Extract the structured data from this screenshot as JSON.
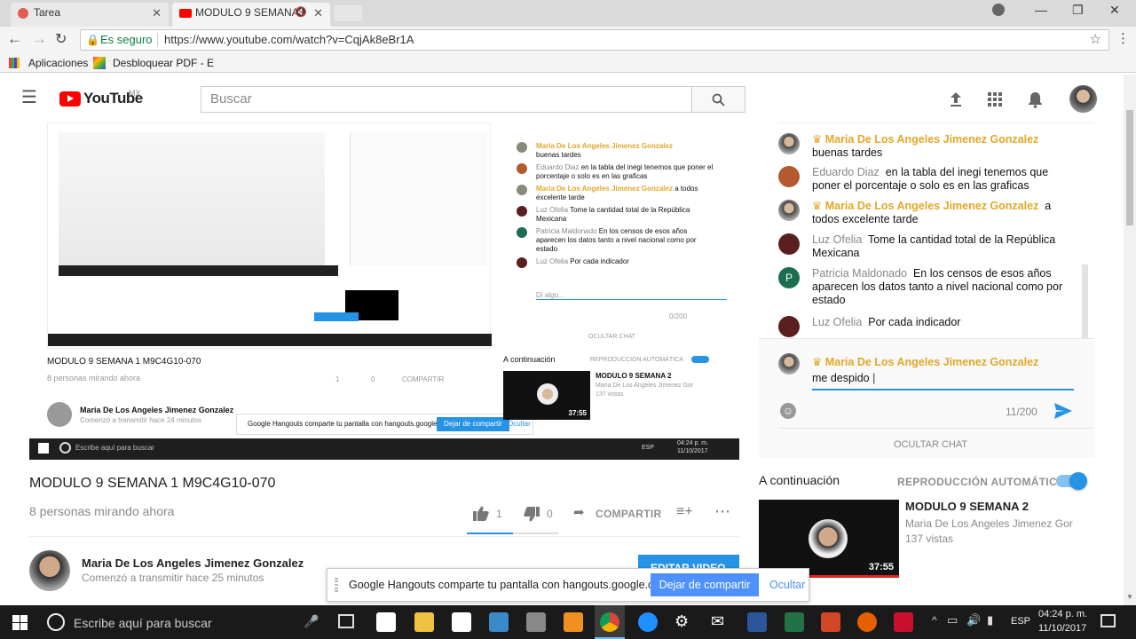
{
  "browser": {
    "tabs": [
      {
        "title": "Tarea",
        "active": false
      },
      {
        "title": "MODULO 9 SEMANA",
        "active": true
      }
    ],
    "security_label": "Es seguro",
    "url": "https://www.youtube.com/watch?v=CqjAk8eBr1A",
    "bookmarks": [
      "Aplicaciones",
      "Desbloquear PDF - E"
    ]
  },
  "youtube": {
    "logo_text": "YouTube",
    "region": "MX",
    "search_placeholder": "Buscar"
  },
  "player_screen": {
    "title": "MODULO 9 SEMANA 1 M9C4G10-070",
    "viewers": "8 personas mirando ahora",
    "likes": "1",
    "dislikes": "0",
    "share": "COMPARTIR",
    "channel": "Maria De Los Angeles Jimenez Gonzalez",
    "started": "Comenzó a transmitir hace 24 minutos",
    "hangouts_text": "Google Hangouts comparte tu pantalla con hangouts.google.com.",
    "hangouts_stop": "Dejar de compartir",
    "hangouts_hide": "Ocultar",
    "chat_messages": [
      {
        "author": "Maria De Los Angeles Jimenez Gonzalez",
        "text": "buenas tardes"
      },
      {
        "author": "Eduardo Diaz",
        "text": "en la tabla del inegi tenemos que poner el porcentaje o solo es en las graficas"
      },
      {
        "author": "Maria De Los Angeles Jimenez Gonzalez",
        "text": "a todos excelente tarde"
      },
      {
        "author": "Luz Ofelia",
        "text": "Tome la cantidad total de la República Mexicana"
      },
      {
        "author": "Patricia Maldonado",
        "text": "En los censos de esos años aparecen los datos tanto a nivel nacional como por estado"
      },
      {
        "author": "Luz Ofelia",
        "text": "Por cada indicador"
      }
    ],
    "input_placeholder": "Di algo...",
    "counter": "0/200",
    "hide_chat": "OCULTAR CHAT",
    "up_next": "A continuación",
    "autoplay": "REPRODUCCIÓN AUTOMÁTICA",
    "next_title": "MODULO 9 SEMANA 2",
    "next_channel": "Maria De Los Angeles Jimenez Gor",
    "next_views": "137 vistas",
    "next_duration": "37:55",
    "taskbar_search": "Escribe aquí para buscar",
    "taskbar_lang": "ESP",
    "taskbar_time": "04:24 p. m.",
    "taskbar_date": "11/10/2017"
  },
  "video": {
    "title": "MODULO 9 SEMANA 1 M9C4G10-070",
    "viewers": "8 personas mirando ahora",
    "likes": "1",
    "dislikes": "0",
    "share": "COMPARTIR",
    "like_ratio": 1.0
  },
  "channel": {
    "name": "Maria De Los Angeles Jimenez Gonzalez",
    "started": "Comenzó a transmitir hace 25 minutos",
    "button_partial": "EDITAR VIDEO"
  },
  "chat": {
    "messages": [
      {
        "author": "Maria De Los Angeles Jimenez Gonzalez",
        "text": "buenas tardes",
        "owner": true
      },
      {
        "author": "Eduardo Diaz",
        "text": "en la tabla del inegi tenemos que poner el porcentaje o solo es en las graficas",
        "owner": false
      },
      {
        "author": "Maria De Los Angeles Jimenez Gonzalez",
        "text": "a todos excelente tarde",
        "owner": true
      },
      {
        "author": "Luz Ofelia",
        "text": "Tome la cantidad total de la República Mexicana",
        "owner": false
      },
      {
        "author": "Patricia Maldonado",
        "text": "En los censos de esos años aparecen los datos tanto a nivel nacional como por estado",
        "owner": false
      },
      {
        "author": "Luz Ofelia",
        "text": "Por cada indicador",
        "owner": false
      }
    ],
    "input_author": "Maria De Los Angeles Jimenez Gonzalez",
    "input_value": "me despido",
    "counter": "11/200",
    "hide_chat": "OCULTAR CHAT"
  },
  "up_next": {
    "label": "A continuación",
    "autoplay": "REPRODUCCIÓN AUTOMÁTICA",
    "autoplay_on": true,
    "title": "MODULO 9 SEMANA 2",
    "channel": "Maria De Los Angeles Jimenez Gor",
    "views": "137 vistas",
    "duration": "37:55"
  },
  "hangouts": {
    "text": "Google Hangouts comparte tu pantalla con hangouts.google.com.",
    "stop": "Dejar de compartir",
    "hide": "Ocultar"
  },
  "taskbar": {
    "search": "Escribe aquí para buscar",
    "lang": "ESP",
    "time": "04:24 p. m.",
    "date": "11/10/2017"
  },
  "colors": {
    "youtube_red": "#ff0000",
    "owner_gold": "#e2a728",
    "accent_blue": "#2793e6",
    "taskbar": "#1a1a1a"
  }
}
